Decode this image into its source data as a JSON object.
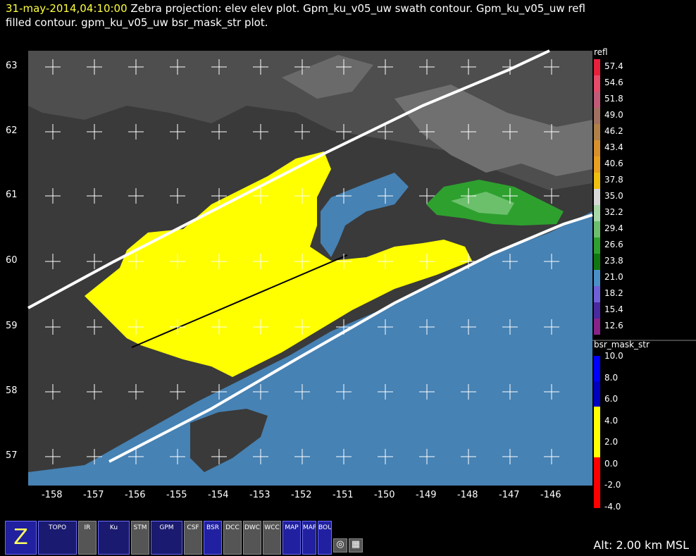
{
  "header": {
    "timestamp": "31-may-2014,04:10:00",
    "line1": "Zebra projection: elev elev  plot.  Gpm_ku_v05_uw swath contour.  Gpm_ku_v05_uw refl",
    "line2": "filled contour.  gpm_ku_v05_uw bsr_mask_str  plot."
  },
  "map": {
    "y_ticks": [
      "63",
      "62",
      "61",
      "60",
      "59",
      "58",
      "57"
    ],
    "x_ticks": [
      "-158",
      "-157",
      "-156",
      "-155",
      "-154",
      "-153",
      "-152",
      "-151",
      "-150",
      "-149",
      "-148",
      "-147",
      "-146"
    ],
    "colors": {
      "ocean": "#4682b4",
      "land_dark": "#3a3a3a",
      "precip": "#ffff00",
      "swath": "#ffffff"
    }
  },
  "legend_refl": {
    "title": "refl",
    "labels": [
      "57.4",
      "54.6",
      "51.8",
      "49.0",
      "46.2",
      "43.4",
      "40.6",
      "37.8",
      "35.0",
      "32.2",
      "29.4",
      "26.6",
      "23.8",
      "21.0",
      "18.2",
      "15.4",
      "12.6"
    ],
    "colors": [
      "#e8203c",
      "#e84a6a",
      "#c05a78",
      "#a07060",
      "#b08048",
      "#d8902c",
      "#e8a020",
      "#f0c010",
      "#d8d8d8",
      "#a8d8a8",
      "#6cc06c",
      "#2ea02e",
      "#107810",
      "#4a90c8",
      "#7060d8",
      "#4a2aa0",
      "#882288"
    ]
  },
  "legend_bsr": {
    "title": "bsr_mask_str",
    "labels": [
      "10.0",
      "8.0",
      "6.0",
      "4.0",
      "2.0",
      "0.0",
      "-2.0",
      "-4.0"
    ],
    "colors": [
      "#0000ff",
      "#0000c0",
      "#ffff00",
      "#ffff00",
      "#ff0000",
      "#ff0000"
    ]
  },
  "toolbar": {
    "buttons": [
      {
        "label": "Z"
      },
      {
        "label": "TOPO"
      },
      {
        "label": "IR"
      },
      {
        "label": "Ku"
      },
      {
        "label": "STM"
      },
      {
        "label": "GPM"
      },
      {
        "label": "CSF"
      },
      {
        "label": "BSR"
      },
      {
        "label": "DCC"
      },
      {
        "label": "DWC"
      },
      {
        "label": "WCC"
      },
      {
        "label": "MAP"
      },
      {
        "label": "MAP"
      },
      {
        "label": "BOUNDS"
      }
    ]
  },
  "status": {
    "altitude": "Alt: 2.00 km MSL"
  }
}
